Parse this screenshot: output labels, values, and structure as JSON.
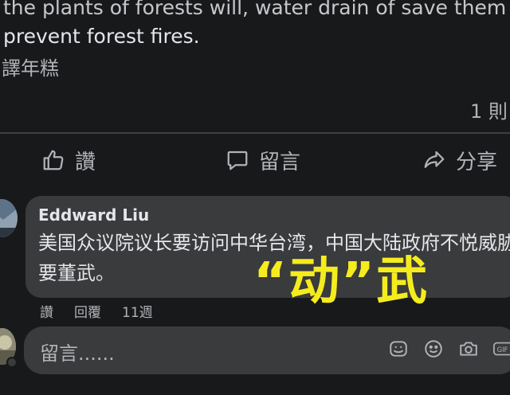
{
  "post": {
    "text_line1_partial": "the plants of forests will, water drain of save them",
    "text_line2": "prevent forest fires.",
    "translate_label": "譯年糕",
    "reactions_count": "1 則"
  },
  "actions": {
    "like": "讚",
    "comment": "留言",
    "share": "分享"
  },
  "comment": {
    "author": "Eddward Liu",
    "body": "美国众议院议长要访问中华台湾，中国大陆政府不悦威胁要董武。",
    "overlay_text": "“动”武",
    "like": "讚",
    "reply": "回覆",
    "time": "11週"
  },
  "reply_box": {
    "placeholder": "留言......"
  },
  "icons": [
    "like-icon",
    "comment-icon",
    "share-icon",
    "sticker-icon",
    "emoji-icon",
    "camera-icon",
    "gif-icon"
  ],
  "colors": {
    "background": "#18191a",
    "bubble": "#3a3b3c",
    "text": "#e4e6eb",
    "secondary": "#b0b3b8",
    "overlay": "#f5ec1e"
  }
}
